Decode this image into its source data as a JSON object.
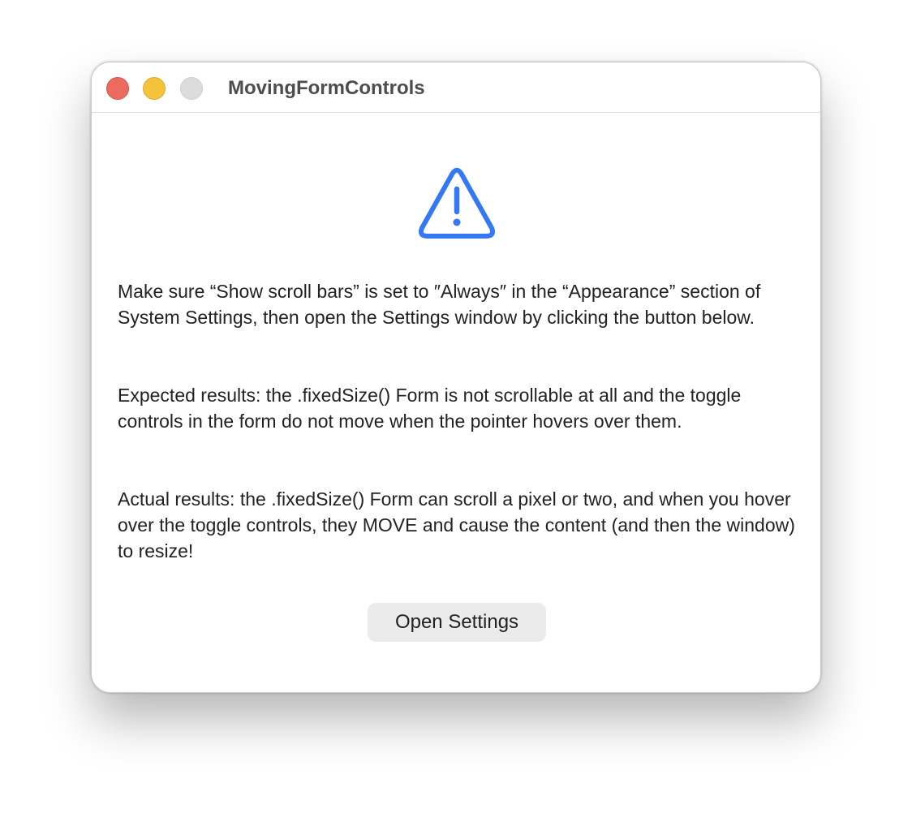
{
  "window": {
    "title": "MovingFormControls"
  },
  "traffic_lights": {
    "close_color": "#ed6a5e",
    "minimize_color": "#f5c33b",
    "zoom_color": "#dcdcdc"
  },
  "alert": {
    "icon": "exclamationmark-triangle-icon",
    "icon_color": "#3478f6",
    "paragraphs": [
      "Make sure “Show scroll bars” is set to ″Always″ in the “Appearance” section of System Settings, then open the Settings window by clicking the button below.",
      "Expected results: the .fixedSize() Form is not scrollable at all and the toggle controls in the form do not move when the pointer hovers over them.",
      "Actual results: the .fixedSize() Form can scroll a pixel or two, and when you hover over the toggle controls, they MOVE and cause the content (and then the window) to resize!"
    ]
  },
  "actions": {
    "open_settings_label": "Open Settings"
  }
}
